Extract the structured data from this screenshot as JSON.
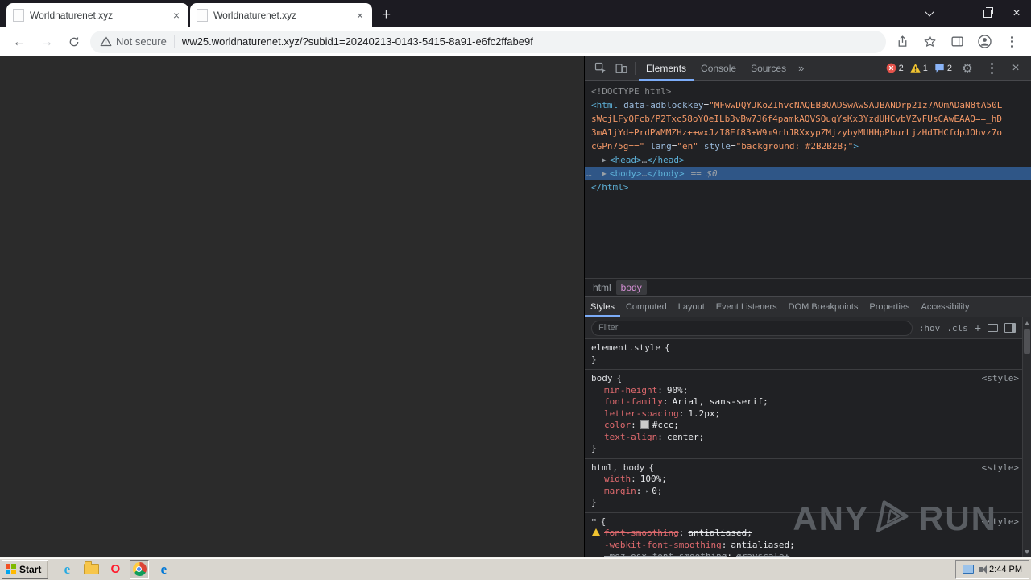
{
  "icons": {
    "close_x": "×",
    "back_arrow": "←",
    "forward_arrow": "→",
    "new_tab_plus": "+",
    "gear": "⚙",
    "more_chevrons": "»",
    "expand_arrow": "▶",
    "shorthand_arrow": "▸",
    "overflow_dots": "…"
  },
  "browser": {
    "tab1_title": "Worldnaturenet.xyz",
    "tab2_title": "Worldnaturenet.xyz",
    "security_label": "Not secure",
    "url": "ww25.worldnaturenet.xyz/?subid1=20240213-0143-5415-8a91-e6fc2ffabe9f"
  },
  "devtools": {
    "tab_elements": "Elements",
    "tab_console": "Console",
    "tab_sources": "Sources",
    "error_count": "2",
    "warning_count": "1",
    "issue_count": "2",
    "tree": {
      "doctype": "<!DOCTYPE html>",
      "html_open": "<html",
      "attr_name": "data-adblockkey",
      "attr_eq": "=",
      "val_l1": "\"MFwwDQYJKoZIhvcNAQEBBQADSwAwSAJBANDrp21z7AOmADaN8tA50L",
      "val_l2": "sWcjLFyQFcb/P2Txc58oYOeILb3vBw7J6f4pamkAQVSQuqYsKx3YzdUHCvbVZvFUsCAwEAAQ==_hD",
      "val_l3": "3mA1jYd+PrdPWMMZHz++wxJzI8Ef83+W9m9rhJRXxypZMjzybyMUHHpPburLjzHdTHCfdpJOhvz7o",
      "val_l4": "cGPn75g==\"",
      "lang_name": "lang",
      "lang_val": "\"en\"",
      "style_name": "style",
      "style_val": "\"background: #2B2B2B;\"",
      "gt": ">",
      "ellipsis": "…",
      "head_open": "<head>",
      "head_close": "</head>",
      "body_open": "<body>",
      "body_close": "</body>",
      "selected_marker": "== $0",
      "html_close": "</html>"
    },
    "crumb_html": "html",
    "crumb_body": "body",
    "sidebar_tabs": {
      "styles": "Styles",
      "computed": "Computed",
      "layout": "Layout",
      "event_listeners": "Event Listeners",
      "dom_breakpoints": "DOM Breakpoints",
      "properties": "Properties",
      "accessibility": "Accessibility"
    },
    "filter_placeholder": "Filter",
    "pseudo_btn": ":hov",
    "class_btn": ".cls",
    "add_btn": "+",
    "styles": {
      "element_style_selector": "element.style",
      "open_brace": "{",
      "close_brace": "}",
      "colon": ":",
      "style_link": "<style>",
      "rule_body": {
        "selector": "body",
        "props": [
          {
            "name": "min-height",
            "value": "90%;"
          },
          {
            "name": "font-family",
            "value": "Arial, sans-serif;"
          },
          {
            "name": "letter-spacing",
            "value": "1.2px;"
          },
          {
            "name": "color",
            "value": "#ccc;"
          },
          {
            "name": "text-align",
            "value": "center;"
          }
        ]
      },
      "rule_html_body": {
        "selector": "html, body",
        "props": [
          {
            "name": "width",
            "value": "100%;"
          },
          {
            "name": "margin",
            "value": "0;"
          }
        ]
      },
      "rule_star": {
        "selector": "*",
        "props": [
          {
            "name": "font-smoothing",
            "value": "antialiased;"
          },
          {
            "name": "-webkit-font-smoothing",
            "value": "antialiased;"
          },
          {
            "name": "-moz-osx-font-smoothing",
            "value": "grayscale;"
          }
        ]
      }
    }
  },
  "watermark": {
    "word_left": "ANY",
    "word_right": "RUN"
  },
  "taskbar": {
    "start_label": "Start",
    "clock": "2:44 PM"
  }
}
